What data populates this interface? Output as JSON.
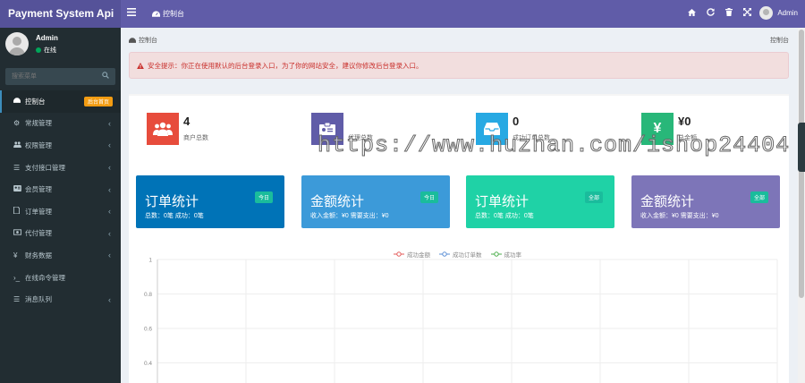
{
  "app": {
    "title": "Payment System Api"
  },
  "topbar": {
    "menu_icon": "hamburger-icon",
    "tab_label": "控制台",
    "icons": [
      "home-icon",
      "refresh-icon",
      "trash-icon",
      "fullscreen-icon"
    ],
    "user_name": "Admin"
  },
  "sidebar": {
    "user_name": "Admin",
    "status": "在线",
    "search_placeholder": "搜索菜单",
    "items": [
      {
        "label": "控制台",
        "icon": "dashboard-icon",
        "badge": "后台首页",
        "active": true
      },
      {
        "label": "常规管理",
        "icon": "cogs-icon"
      },
      {
        "label": "权限管理",
        "icon": "group-icon"
      },
      {
        "label": "支付接口管理",
        "icon": "list-icon"
      },
      {
        "label": "会员管理",
        "icon": "user-card-icon"
      },
      {
        "label": "订单管理",
        "icon": "file-icon"
      },
      {
        "label": "代付管理",
        "icon": "money-icon"
      },
      {
        "label": "财务数据",
        "icon": "yen-icon"
      },
      {
        "label": "在线命令管理",
        "icon": "terminal-icon"
      },
      {
        "label": "消息队列",
        "icon": "list-icon"
      }
    ]
  },
  "breadcrumb": {
    "label": "控制台",
    "right": "控制台"
  },
  "alert": {
    "text": "安全提示：你正在使用默认的后台登录入口，为了你的网站安全，建议你修改后台登录入口。"
  },
  "stats": [
    {
      "value": "4",
      "label": "商户总数",
      "icon": "users-icon",
      "color": "#e74c3c"
    },
    {
      "value": "",
      "label": "代理总数",
      "icon": "id-card-icon",
      "color": "#605ca8"
    },
    {
      "value": "0",
      "label": "成功订单总数",
      "icon": "inbox-icon",
      "color": "#27a9e3"
    },
    {
      "value": "¥0",
      "label": "总金额",
      "icon": "yen-icon",
      "color": "#28b779"
    }
  ],
  "cards": [
    {
      "title": "订单统计",
      "badge": "今日",
      "sub": "总数：0笔 成功：0笔",
      "color": "#0073b7"
    },
    {
      "title": "金额统计",
      "badge": "今日",
      "sub": "收入金额：¥0 需要支出：¥0",
      "color": "#3c8dbc"
    },
    {
      "title": "订单统计",
      "badge": "全部",
      "sub": "总数：0笔 成功：0笔",
      "color": "#1fd2a6"
    },
    {
      "title": "金额统计",
      "badge": "全部",
      "sub": "收入金额：¥0 需要支出：¥0",
      "color": "#7d75b8"
    }
  ],
  "chart_data": {
    "type": "line",
    "series": [
      {
        "name": "成功金额",
        "color": "#e35b5a"
      },
      {
        "name": "成功订单数",
        "color": "#5b8fd6"
      },
      {
        "name": "成功率",
        "color": "#4cae4c"
      }
    ],
    "yticks": [
      "1",
      "0.8",
      "0.6",
      "0.4"
    ],
    "ylim": [
      0,
      1
    ],
    "grid": true
  },
  "watermark": "https://www.huzhan.com/ishop24404"
}
